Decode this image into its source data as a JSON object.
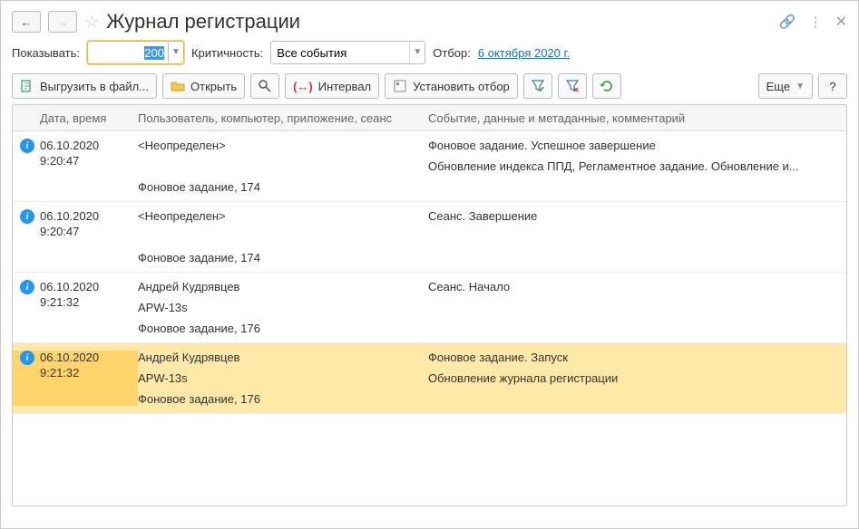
{
  "header": {
    "title": "Журнал регистрации"
  },
  "filter": {
    "show_label": "Показывать:",
    "show_value": "200",
    "severity_label": "Критичность:",
    "severity_value": "Все события",
    "selection_label": "Отбор:",
    "selection_date": "6 октября 2020 г."
  },
  "toolbar": {
    "export": "Выгрузить в файл...",
    "open": "Открыть",
    "interval": "Интервал",
    "set_filter": "Установить отбор",
    "more": "Еще"
  },
  "grid": {
    "columns": [
      "Дата, время",
      "Пользователь, компьютер, приложение, сеанс",
      "Событие, данные и метаданные, комментарий"
    ],
    "rows": [
      {
        "date": "06.10.2020",
        "time": "9:20:47",
        "user_lines": [
          "<Неопределен>",
          "",
          "Фоновое задание, 174"
        ],
        "event_lines": [
          "Фоновое задание. Успешное завершение",
          "Обновление индекса ППД, Регламентное задание. Обновление и...",
          ""
        ],
        "selected": false
      },
      {
        "date": "06.10.2020",
        "time": "9:20:47",
        "user_lines": [
          "<Неопределен>",
          "",
          "Фоновое задание, 174"
        ],
        "event_lines": [
          "Сеанс. Завершение",
          "",
          ""
        ],
        "selected": false
      },
      {
        "date": "06.10.2020",
        "time": "9:21:32",
        "user_lines": [
          "Андрей Кудрявцев",
          "APW-13s",
          "Фоновое задание, 176"
        ],
        "event_lines": [
          "Сеанс. Начало",
          "",
          ""
        ],
        "selected": false
      },
      {
        "date": "06.10.2020",
        "time": "9:21:32",
        "user_lines": [
          "Андрей Кудрявцев",
          "APW-13s",
          "Фоновое задание, 176"
        ],
        "event_lines": [
          "Фоновое задание. Запуск",
          "Обновление журнала регистрации",
          ""
        ],
        "selected": true
      }
    ]
  }
}
